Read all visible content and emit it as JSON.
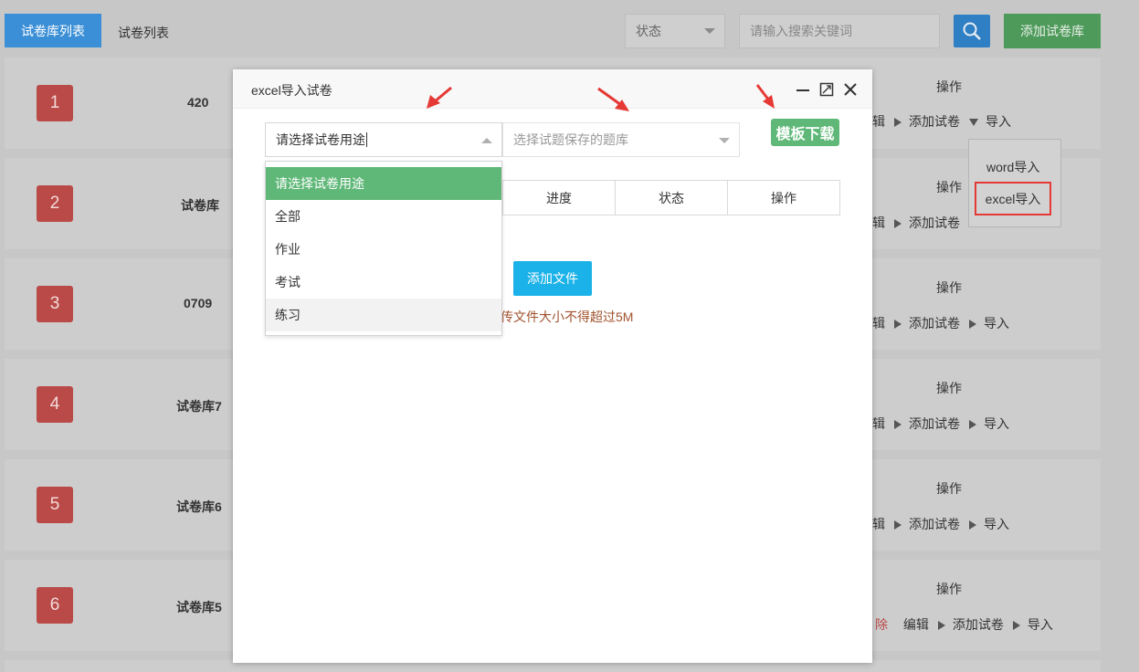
{
  "topbar": {
    "tab_active": "试卷库列表",
    "tab_plain": "试卷列表",
    "status_select": "状态",
    "search_placeholder": "请输入搜索关键词",
    "add_library_button": "添加试卷库"
  },
  "rows": [
    {
      "num": "1",
      "name": "420",
      "op_head": "操作",
      "links": [
        "辑",
        "添加试卷",
        "导入"
      ]
    },
    {
      "num": "2",
      "name": "试卷库",
      "op_head": "操作",
      "links": [
        "辑",
        "添加试卷"
      ]
    },
    {
      "num": "3",
      "name": "0709",
      "op_head": "操作",
      "links": [
        "辑",
        "添加试卷",
        "导入"
      ]
    },
    {
      "num": "4",
      "name": "试卷库7",
      "op_head": "操作",
      "links": [
        "辑",
        "添加试卷",
        "导入"
      ]
    },
    {
      "num": "5",
      "name": "试卷库6",
      "op_head": "操作",
      "links": [
        "辑",
        "添加试卷",
        "导入"
      ]
    },
    {
      "num": "6",
      "name": "试卷库5",
      "op_head": "操作",
      "links": [
        "除",
        "编辑",
        "添加试卷",
        "导入"
      ]
    }
  ],
  "import_menu": {
    "word": "word导入",
    "excel": "excel导入"
  },
  "modal": {
    "title": "excel导入试卷",
    "purpose_select_value": "请选择试卷用途",
    "bank_select_placeholder": "选择试题保存的题库",
    "template_download": "模板下载",
    "table_headers": [
      "进度",
      "状态",
      "操作"
    ],
    "add_file_button": "添加文件",
    "size_note": "传文件大小不得超过5M",
    "purpose_options": [
      "请选择试卷用途",
      "全部",
      "作业",
      "考试",
      "练习"
    ]
  },
  "colors": {
    "primary_blue": "#3b8fd6",
    "green": "#5fb878",
    "badge_red": "#b94a48",
    "highlight_red": "#e53935",
    "cyan_button": "#1ab2e8"
  }
}
